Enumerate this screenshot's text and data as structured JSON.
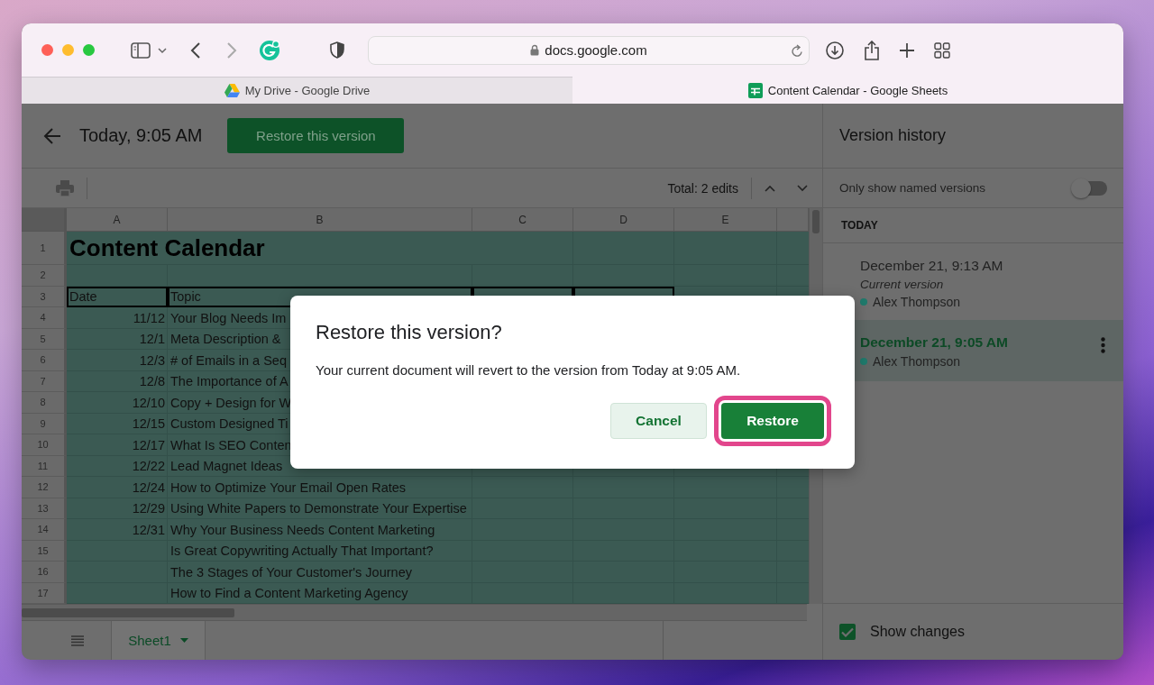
{
  "browser": {
    "url": "docs.google.com",
    "tabs": [
      {
        "title": "My Drive - Google Drive",
        "selected": false
      },
      {
        "title": "Content Calendar - Google Sheets",
        "selected": true
      }
    ]
  },
  "header": {
    "title": "Today, 9:05 AM",
    "restore_button": "Restore this version"
  },
  "toolbar": {
    "total": "Total: 2 edits"
  },
  "sheet": {
    "columns": [
      "A",
      "B",
      "C",
      "D",
      "E"
    ],
    "rows": [
      {
        "number": "1",
        "kind": "title",
        "title": "Content Calendar"
      },
      {
        "number": "2",
        "kind": "blank"
      },
      {
        "number": "3",
        "kind": "header",
        "cells": [
          "Date",
          "Topic"
        ]
      },
      {
        "number": "4",
        "kind": "data",
        "date": "11/12",
        "topic": "Your Blog Needs Im"
      },
      {
        "number": "5",
        "kind": "data",
        "date": "12/1",
        "topic": "Meta Description &"
      },
      {
        "number": "6",
        "kind": "data",
        "date": "12/3",
        "topic": "# of Emails in a Seq"
      },
      {
        "number": "7",
        "kind": "data",
        "date": "12/8",
        "topic": "The Importance of A"
      },
      {
        "number": "8",
        "kind": "data",
        "date": "12/10",
        "topic": "Copy + Design for W"
      },
      {
        "number": "9",
        "kind": "data",
        "date": "12/15",
        "topic": "Custom Designed Ti"
      },
      {
        "number": "10",
        "kind": "data",
        "date": "12/17",
        "topic": "What Is SEO Conten"
      },
      {
        "number": "11",
        "kind": "data",
        "date": "12/22",
        "topic": "Lead Magnet Ideas"
      },
      {
        "number": "12",
        "kind": "data",
        "date": "12/24",
        "topic": "How to Optimize Your Email Open Rates"
      },
      {
        "number": "13",
        "kind": "data",
        "date": "12/29",
        "topic": "Using White Papers to Demonstrate Your Expertise"
      },
      {
        "number": "14",
        "kind": "data",
        "date": "12/31",
        "topic": "Why Your Business Needs Content Marketing"
      },
      {
        "number": "15",
        "kind": "data",
        "topic": "Is Great Copywriting Actually That Important?"
      },
      {
        "number": "16",
        "kind": "data",
        "topic": "The 3 Stages of Your Customer's Journey"
      },
      {
        "number": "17",
        "kind": "data",
        "topic": "How to Find a Content Marketing Agency"
      }
    ]
  },
  "sheet_tabs": [
    {
      "label": "Sheet1",
      "selected": true
    }
  ],
  "sidebar": {
    "title": "Version history",
    "named_toggle": {
      "label": "Only show named versions",
      "on": false
    },
    "section": "TODAY",
    "versions": [
      {
        "time": "December 21, 9:13 AM",
        "note": "Current version",
        "author": "Alex Thompson",
        "color": "#1f7a6c",
        "selected": false
      },
      {
        "time": "December 21, 9:05 AM",
        "author": "Alex Thompson",
        "color": "#1f7a6c",
        "selected": true
      }
    ],
    "show_changes": {
      "label": "Show changes",
      "checked": true
    }
  },
  "dialog": {
    "title": "Restore this version?",
    "message": "Your current document will revert to the version from Today at 9:05 AM.",
    "buttons": [
      {
        "label": "Cancel",
        "kind": "secondary",
        "highlighted": false
      },
      {
        "label": "Restore",
        "kind": "primary",
        "highlighted": true
      }
    ]
  }
}
